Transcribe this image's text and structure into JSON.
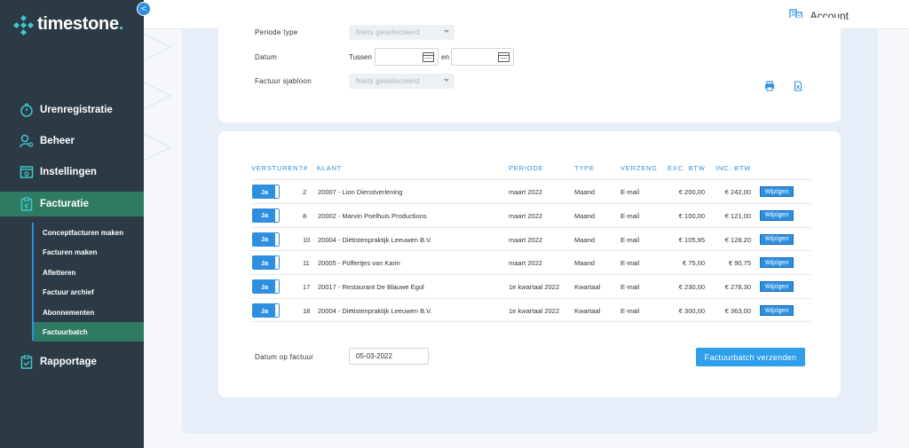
{
  "app": {
    "logo_text": "timestone",
    "logo_dot": ".",
    "collapse_icon": "<"
  },
  "topbar": {
    "account_label": "Account"
  },
  "sidebar": {
    "items": [
      {
        "label": "Urenregistratie",
        "icon": "stopwatch-icon"
      },
      {
        "label": "Beheer",
        "icon": "user-gear-icon"
      },
      {
        "label": "Instellingen",
        "icon": "settings-window-icon"
      },
      {
        "label": "Facturatie",
        "icon": "clipboard-euro-icon"
      },
      {
        "label": "Rapportage",
        "icon": "clipboard-check-icon"
      }
    ],
    "sub_items": [
      {
        "label": "Conceptfacturen maken"
      },
      {
        "label": "Facturen maken"
      },
      {
        "label": "Afletteren"
      },
      {
        "label": "Factuur archief"
      },
      {
        "label": "Abonnementen"
      },
      {
        "label": "Factuurbatch"
      }
    ]
  },
  "filters": {
    "periode_type_label": "Periode type",
    "periode_type_value": "Niets geselecteerd",
    "datum_label": "Datum",
    "tussen_label": "Tussen",
    "en_label": "en",
    "sjabloon_label": "Factuur sjabloon",
    "sjabloon_value": "Niets geselecteerd"
  },
  "table": {
    "headers": {
      "versturen": "VERSTUREN?",
      "nr": "#",
      "klant": "KLANT",
      "periode": "PERIODE",
      "type": "TYPE",
      "verzend": "VERZEND",
      "excl": "EXC. BTW",
      "incl": "INC. BTW"
    },
    "toggle_label": "Ja",
    "edit_label": "Wijzigen",
    "rows": [
      {
        "nr": "2",
        "klant": "20007 - Lion Dienstverlening",
        "periode": "maart 2022",
        "type": "Maand",
        "verzend": "E-mail",
        "excl": "€ 200,00",
        "incl": "€ 242,00"
      },
      {
        "nr": "8",
        "klant": "20002 - Marvin Poelhuis Productions",
        "periode": "maart 2022",
        "type": "Maand",
        "verzend": "E-mail",
        "excl": "€ 100,00",
        "incl": "€ 121,00"
      },
      {
        "nr": "10",
        "klant": "20004 - Diëtistenpraktijk Leeuwen B.V.",
        "periode": "maart 2022",
        "type": "Maand",
        "verzend": "E-mail",
        "excl": "€ 105,95",
        "incl": "€ 128,20"
      },
      {
        "nr": "11",
        "klant": "20005 - Poffertjes van Karin",
        "periode": "maart 2022",
        "type": "Maand",
        "verzend": "E-mail",
        "excl": "€ 75,00",
        "incl": "€ 90,75"
      },
      {
        "nr": "17",
        "klant": "20017 - Restaurant De Blauwe Egol",
        "periode": "1e kwartaal 2022",
        "type": "Kwartaal",
        "verzend": "E-mail",
        "excl": "€ 230,00",
        "incl": "€ 278,30"
      },
      {
        "nr": "18",
        "klant": "20004 - Diëtistenpraktijk Leeuwen B.V.",
        "periode": "1e kwartaal 2022",
        "type": "Kwartaal",
        "verzend": "E-mail",
        "excl": "€ 300,00",
        "incl": "€ 363,00"
      }
    ]
  },
  "footer": {
    "datum_label": "Datum op factuur",
    "datum_value": "05-03-2022",
    "send_label": "Factuurbatch verzenden"
  },
  "colors": {
    "sidebar_bg": "#2b3a44",
    "active_bg": "#2f7a63",
    "accent": "#2e8fe0",
    "logo_accent": "#3fc7c9"
  }
}
